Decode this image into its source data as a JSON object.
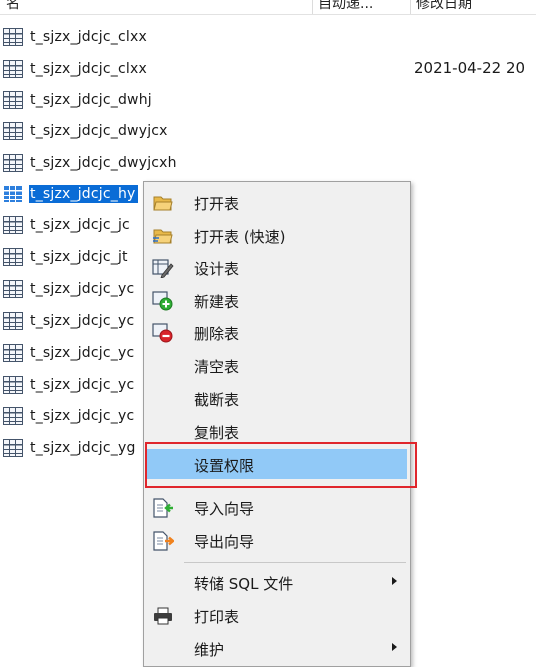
{
  "columns": {
    "name_header": "名",
    "modified_header": "自动递...",
    "date_header": "修改日期"
  },
  "tables": [
    {
      "name": "t_sjzx_jdcjc_clxx"
    },
    {
      "name": "t_sjzx_jdcjc_clxx",
      "modified_date": "2021-04-22 20"
    },
    {
      "name": "t_sjzx_jdcjc_dwhj"
    },
    {
      "name": "t_sjzx_jdcjc_dwyjcx"
    },
    {
      "name": "t_sjzx_jdcjc_dwyjcxh"
    },
    {
      "name": "t_sjzx_jdcjc_hy"
    },
    {
      "name": "t_sjzx_jdcjc_jc"
    },
    {
      "name": "t_sjzx_jdcjc_jt"
    },
    {
      "name": "t_sjzx_jdcjc_yc"
    },
    {
      "name": "t_sjzx_jdcjc_yc"
    },
    {
      "name": "t_sjzx_jdcjc_yc"
    },
    {
      "name": "t_sjzx_jdcjc_yc"
    },
    {
      "name": "t_sjzx_jdcjc_yc"
    },
    {
      "name": "t_sjzx_jdcjc_yg"
    }
  ],
  "selected_table": "t_sjzx_jdcjc_hy",
  "context_menu": {
    "items": [
      {
        "label": "打开表",
        "icon": "folder-open-icon"
      },
      {
        "label": "打开表 (快速)",
        "icon": "folder-open-fast-icon"
      },
      {
        "label": "设计表",
        "icon": "design-pencil-icon"
      },
      {
        "label": "新建表",
        "icon": "add-green-icon"
      },
      {
        "label": "删除表",
        "icon": "delete-red-icon"
      },
      {
        "label": "清空表",
        "icon": ""
      },
      {
        "label": "截断表",
        "icon": ""
      },
      {
        "label": "复制表",
        "icon": ""
      },
      {
        "label": "设置权限",
        "icon": ""
      },
      {
        "label": "导入向导",
        "icon": "import-wizard-icon"
      },
      {
        "label": "导出向导",
        "icon": "export-wizard-icon"
      },
      {
        "label": "转储 SQL 文件",
        "icon": "",
        "submenu": true
      },
      {
        "label": "打印表",
        "icon": "printer-icon"
      },
      {
        "label": "维护",
        "icon": "",
        "submenu": true
      }
    ],
    "active_item": "设置权限"
  },
  "colors": {
    "selection": "#0a6cd6",
    "menu_background": "#f0f0f0",
    "menu_hover": "#91c9f7",
    "highlight_border": "#e0262c"
  }
}
